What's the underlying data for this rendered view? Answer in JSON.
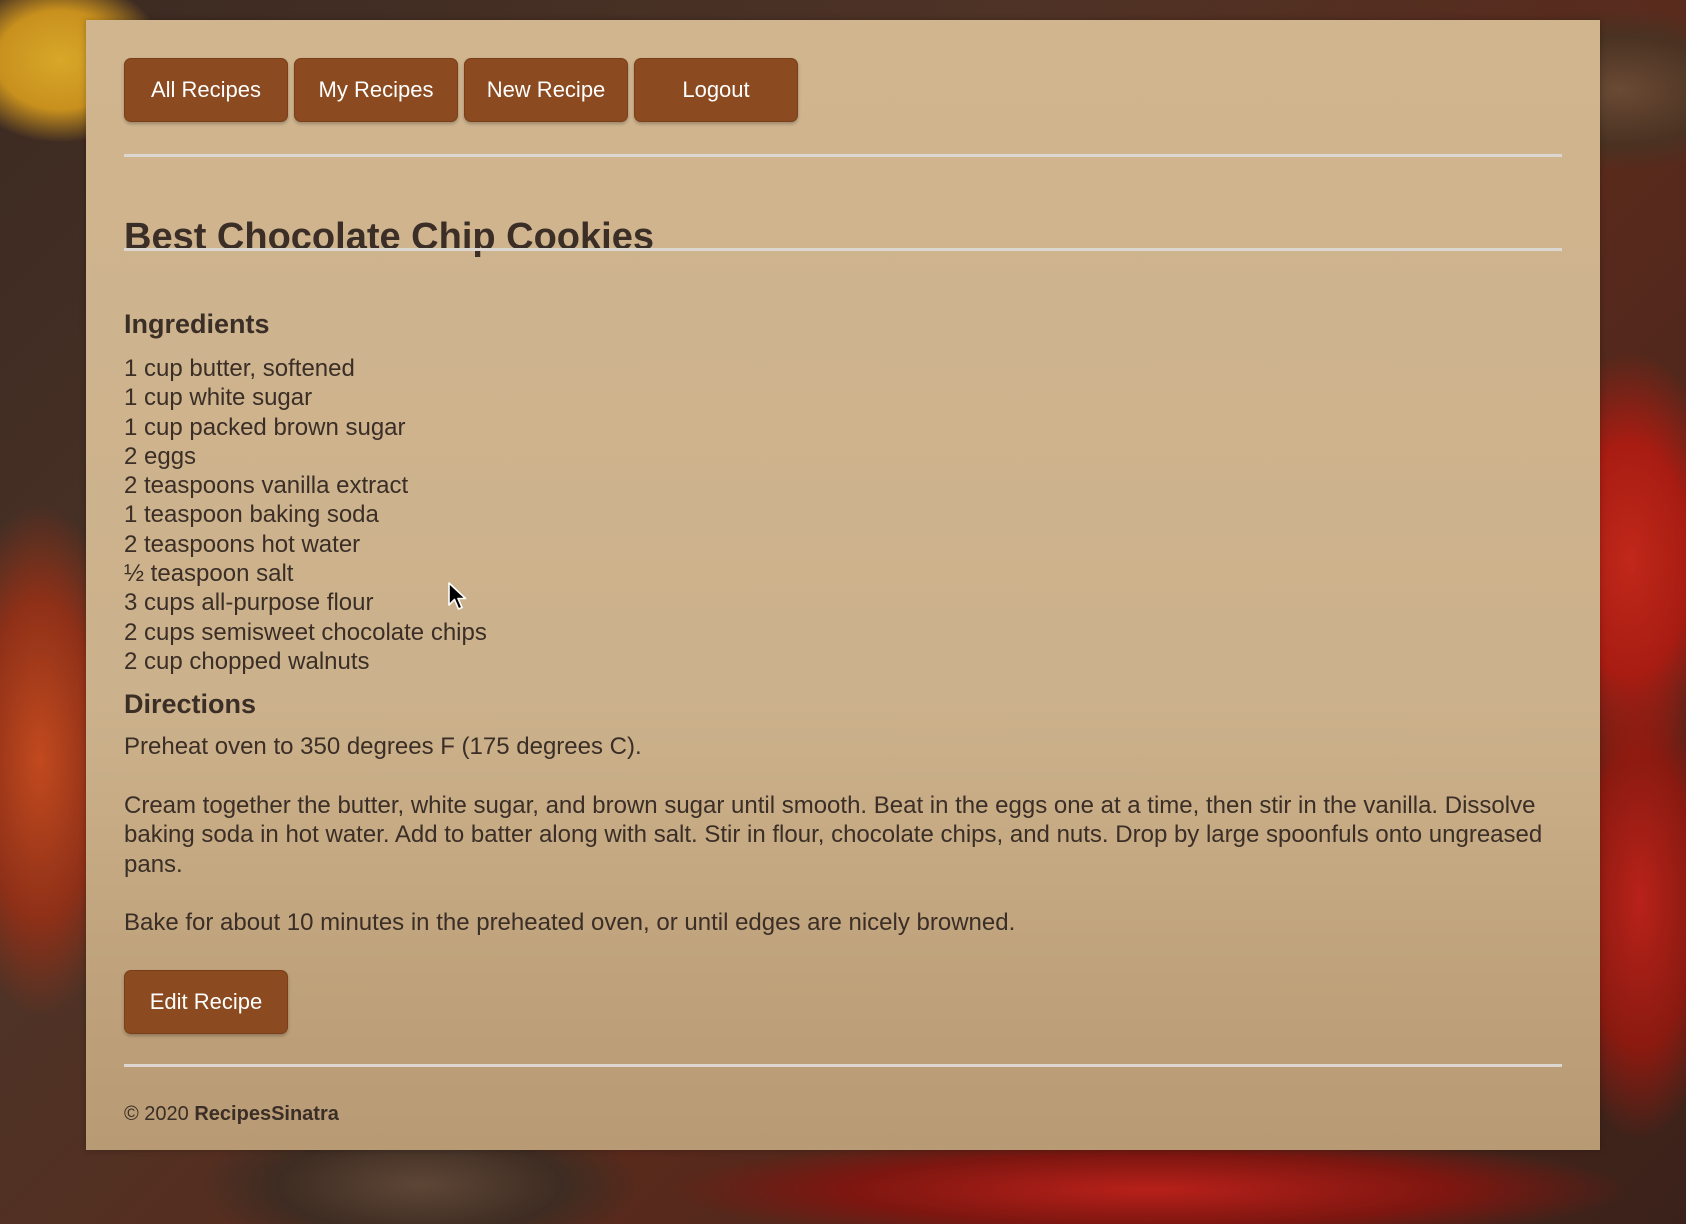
{
  "nav": {
    "buttons": [
      {
        "label": "All Recipes"
      },
      {
        "label": "My Recipes"
      },
      {
        "label": "New Recipe"
      },
      {
        "label": "Logout"
      }
    ]
  },
  "recipe": {
    "title": "Best Chocolate Chip Cookies",
    "ingredients_heading": "Ingredients",
    "ingredients": [
      "1 cup butter, softened",
      "1 cup white sugar",
      "1 cup packed brown sugar",
      "2 eggs",
      "2 teaspoons vanilla extract",
      "1 teaspoon baking soda",
      "2 teaspoons hot water",
      "½ teaspoon salt",
      "3 cups all-purpose flour",
      "2 cups semisweet chocolate chips",
      "2 cup chopped walnuts"
    ],
    "directions_heading": "Directions",
    "directions": [
      "Preheat oven to 350 degrees F (175 degrees C).",
      "Cream together the butter, white sugar, and brown sugar until smooth. Beat in the eggs one at a time, then stir in the vanilla. Dissolve baking soda in hot water. Add to batter along with salt. Stir in flour, chocolate chips, and nuts. Drop by large spoonfuls onto ungreased pans.",
      "Bake for about 10 minutes in the preheated oven, or until edges are nicely browned."
    ],
    "edit_label": "Edit Recipe"
  },
  "footer": {
    "copyright": "© 2020",
    "brand": "RecipesSinatra"
  },
  "colors": {
    "button": "#8b4a1f",
    "panel": "#d0b58f",
    "text": "#3a2e26"
  }
}
